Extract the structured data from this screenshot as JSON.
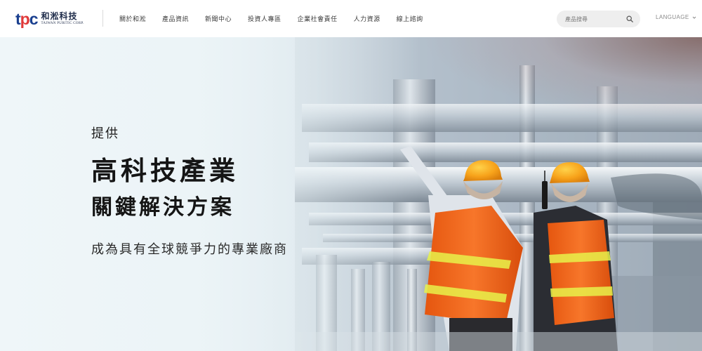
{
  "header": {
    "logo": {
      "mark_t": "t",
      "mark_p": "p",
      "mark_c": "c",
      "name_zh": "和淞科技",
      "name_en": "TAIWAN PURITIC CORP."
    },
    "nav": [
      {
        "label": "關於和淞"
      },
      {
        "label": "產品資訊"
      },
      {
        "label": "新聞中心"
      },
      {
        "label": "投資人專區"
      },
      {
        "label": "企業社會責任"
      },
      {
        "label": "人力資源"
      },
      {
        "label": "線上諮詢"
      }
    ],
    "search": {
      "placeholder": "產品搜尋",
      "icon": "search-icon"
    },
    "language": {
      "label": "LANGUAGE",
      "icon": "chevron-down-icon"
    }
  },
  "hero": {
    "kicker": "提供",
    "title_line1": "高科技產業",
    "title_line2": "關鍵解決方案",
    "subtitle": "成為具有全球競爭力的專業廠商",
    "image": "workers-in-hard-hats-inspecting-industrial-piping",
    "control_icon": "fullscreen-icon"
  },
  "colors": {
    "brand_blue": "#1a3f8f",
    "brand_red": "#e03a3a",
    "text_dark": "#151515",
    "search_bg": "#eeeeee",
    "vest_orange": "#f26a1b",
    "helmet_orange": "#f7a21a"
  }
}
